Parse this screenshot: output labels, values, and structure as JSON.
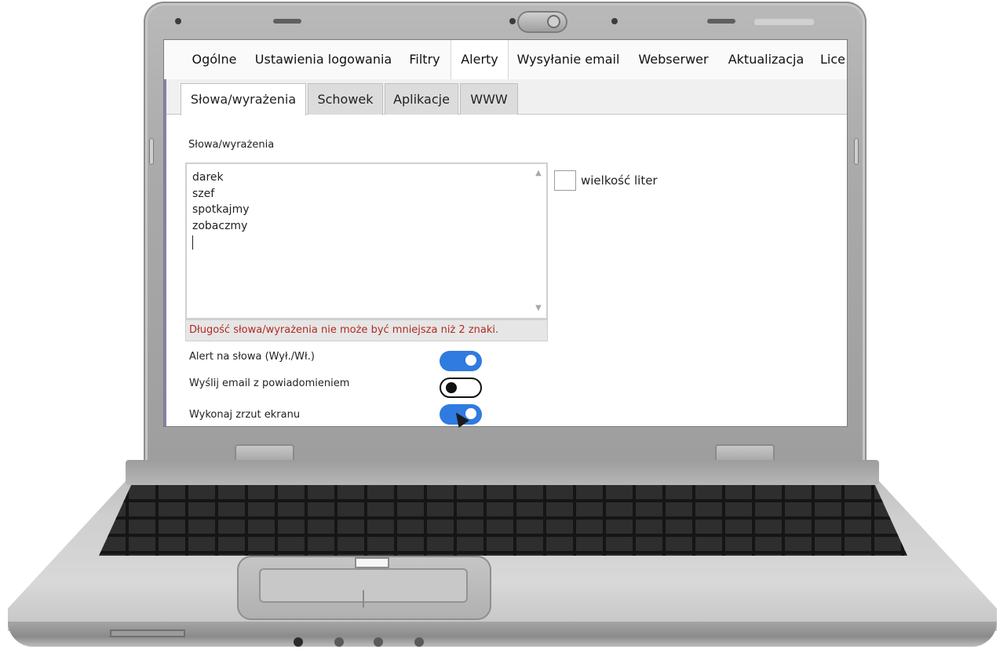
{
  "main_tabs": [
    "Ogólne",
    "Ustawienia logowania",
    "Filtry",
    "Alerty",
    "Wysyłanie email",
    "Webserwer",
    "Aktualizacja",
    "Lice"
  ],
  "active_main_tab": "Alerty",
  "sub_tabs": [
    "Słowa/wyrażenia",
    "Schowek",
    "Aplikacje",
    "WWW"
  ],
  "active_sub_tab": "Słowa/wyrażenia",
  "words_section": {
    "label": "Słowa/wyrażenia",
    "words": [
      "darek",
      "szef",
      "spotkajmy",
      "zobaczmy"
    ],
    "error": "Długość słowa/wyrażenia nie może być mniejsza niż 2 znaki."
  },
  "case_sensitive": {
    "label": "wielkość liter",
    "checked": false
  },
  "options": [
    {
      "label": "Alert na słowa (Wył./Wł.)",
      "enabled": true
    },
    {
      "label": "Wyślij email z powiadomieniem",
      "enabled": false
    },
    {
      "label": "Wykonaj zrzut ekranu",
      "enabled": true
    }
  ],
  "colors": {
    "toggle_on": "#2f7be0",
    "error_text": "#b22a22",
    "panel_accent": "#8a7fa8"
  },
  "icons": {
    "scroll_up": "chevron-up-icon",
    "scroll_down": "chevron-down-icon",
    "pointer": "mouse-pointer-icon"
  }
}
